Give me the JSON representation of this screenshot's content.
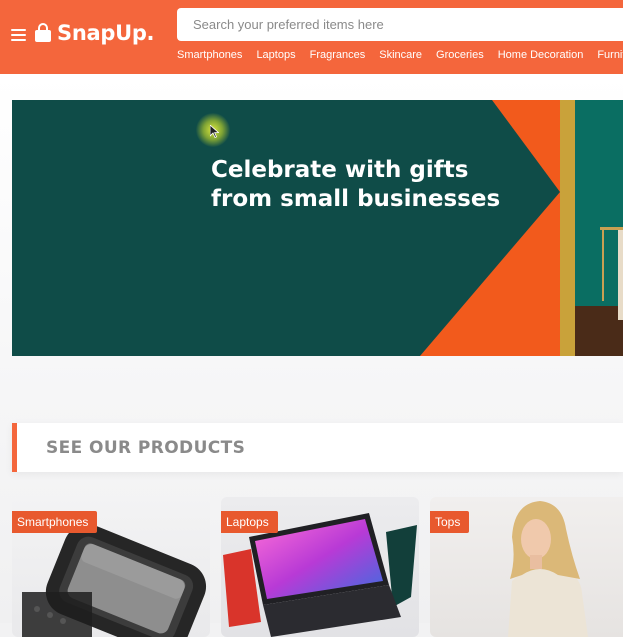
{
  "brand": {
    "name": "SnapUp."
  },
  "search": {
    "placeholder": "Search your preferred items here"
  },
  "nav": {
    "items": [
      "Smartphones",
      "Laptops",
      "Fragrances",
      "Skincare",
      "Groceries",
      "Home Decoration",
      "Furniture"
    ]
  },
  "banner": {
    "title": "Celebrate with gifts from small businesses"
  },
  "products": {
    "heading": "SEE OUR PRODUCTS",
    "cards": [
      {
        "tag": "Smartphones"
      },
      {
        "tag": "Laptops"
      },
      {
        "tag": "Tops"
      }
    ]
  },
  "colors": {
    "brand": "#f4663c",
    "tag": "#e8592e",
    "banner_teal": "#0f4c48"
  },
  "icons": {
    "menu": "hamburger-menu-icon",
    "logo": "shopping-bag-icon"
  }
}
